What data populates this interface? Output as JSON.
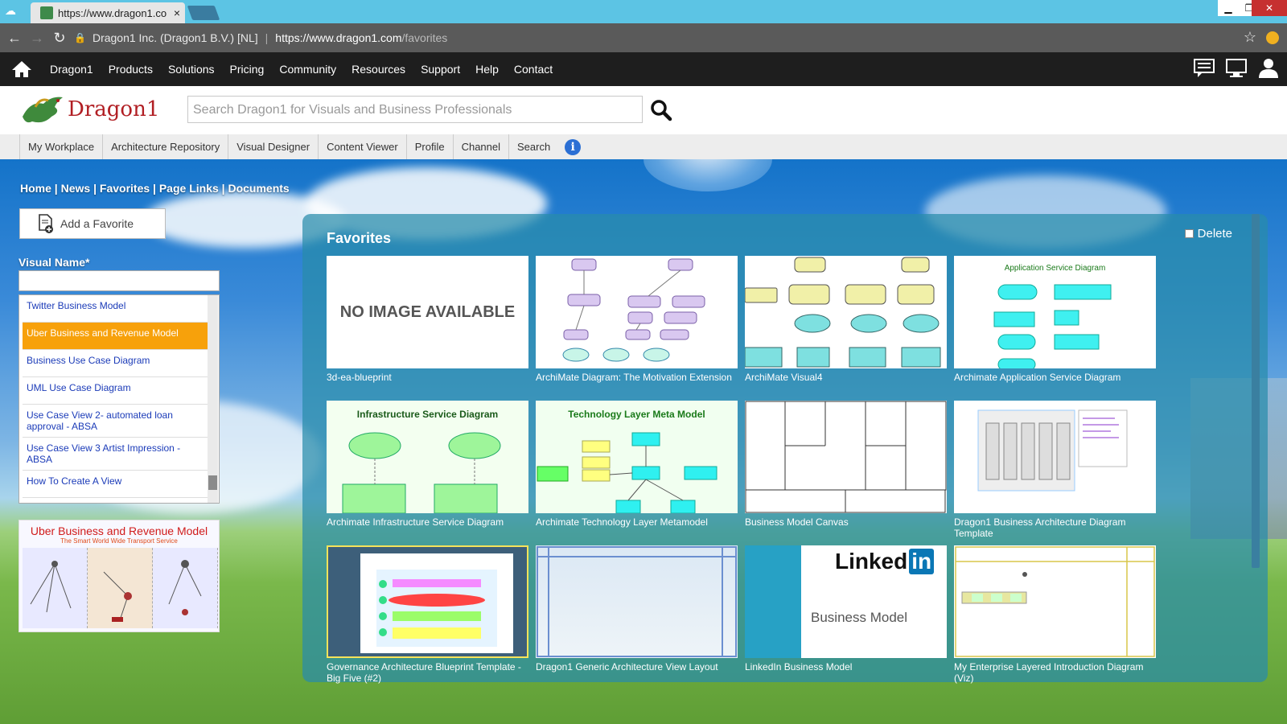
{
  "browser": {
    "tab_title": "https://www.dragon1.co",
    "tab_close": "×",
    "lock_label": "Dragon1 Inc. (Dragon1 B.V.) [NL]",
    "url_host": "https://www.dragon1.com",
    "url_path": "/favorites"
  },
  "topnav": {
    "items": [
      "Dragon1",
      "Products",
      "Solutions",
      "Pricing",
      "Community",
      "Resources",
      "Support",
      "Help",
      "Contact"
    ]
  },
  "header": {
    "logo_text": "Dragon1",
    "search_placeholder": "Search Dragon1 for Visuals and Business Professionals"
  },
  "subnav": {
    "items": [
      "My Workplace",
      "Architecture Repository",
      "Visual Designer",
      "Content Viewer",
      "Profile",
      "Channel",
      "Search"
    ]
  },
  "crumbs": {
    "home": "Home",
    "news": "News",
    "favorites": "Favorites",
    "page_links": "Page Links",
    "documents": "Documents",
    "sep": " | "
  },
  "sidebar": {
    "add_favorite": "Add a Favorite",
    "visual_name_label": "Visual Name*",
    "visual_name_value": "",
    "list": [
      "Twitter Business Model",
      "Uber Business and Revenue Model",
      "Business Use Case Diagram",
      "UML Use Case Diagram",
      "Use Case View 2- automated loan approval - ABSA",
      "Use Case View 3 Artist Impression - ABSA",
      "How To Create A View"
    ],
    "selected_index": 1,
    "preview_title": "Uber Business and Revenue Model",
    "preview_subtitle": "The Smart World Wide Transport Service"
  },
  "favorites": {
    "title": "Favorites",
    "delete_label": "Delete",
    "no_image_text": "NO IMAGE AVAILABLE",
    "items": [
      {
        "label": "3d-ea-blueprint"
      },
      {
        "label": "ArchiMate Diagram: The Motivation Extension"
      },
      {
        "label": "ArchiMate Visual4"
      },
      {
        "label": "Archimate Application Service Diagram",
        "thumb_title": "Application Service Diagram"
      },
      {
        "label": "Archimate Infrastructure Service Diagram",
        "thumb_title": "Infrastructure Service Diagram"
      },
      {
        "label": "Archimate Technology Layer Metamodel",
        "thumb_title": "Technology Layer Meta Model"
      },
      {
        "label": "Business Model Canvas"
      },
      {
        "label": "Dragon1 Business Architecture Diagram Template"
      },
      {
        "label": "Governance Architecture Blueprint Template - Big Five (#2)"
      },
      {
        "label": "Dragon1 Generic Architecture View Layout"
      },
      {
        "label": "LinkedIn Business Model",
        "thumb_brand": "Linked",
        "thumb_brand_in": "in",
        "thumb_sub": "Business Model"
      },
      {
        "label": "My Enterprise Layered Introduction Diagram (Viz)"
      }
    ]
  },
  "colors": {
    "accent": "#f7a10b",
    "brand_red": "#b11e23",
    "link_blue": "#1b3bb8"
  }
}
